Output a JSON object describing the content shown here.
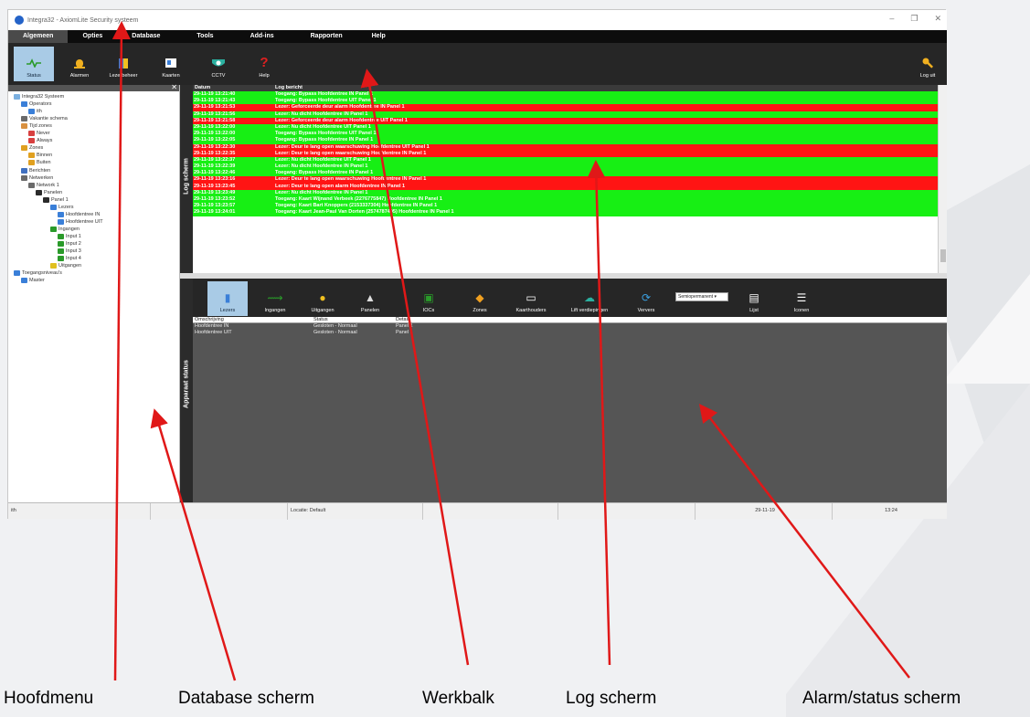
{
  "window": {
    "title": "Integra32 - AxiomLite Security systeem",
    "controls": [
      "–",
      "❐",
      "✕"
    ]
  },
  "menu": [
    "Algemeen",
    "Opties",
    "Database",
    "Tools",
    "Add-ins",
    "Rapporten",
    "Help"
  ],
  "toolbar": {
    "items": [
      {
        "label": "Status",
        "icon": "status-icon"
      },
      {
        "label": "Alarmen",
        "icon": "alarm-icon"
      },
      {
        "label": "Lezerbeheer",
        "icon": "reader-icon"
      },
      {
        "label": "Kaarten",
        "icon": "card-icon"
      },
      {
        "label": "CCTV",
        "icon": "cctv-icon"
      },
      {
        "label": "Help",
        "icon": "help-icon"
      }
    ],
    "logout_label": "Log uit"
  },
  "tree": [
    {
      "label": "Integra32 Systeem",
      "depth": 0
    },
    {
      "label": "Operators",
      "depth": 1
    },
    {
      "label": "ith",
      "depth": 2
    },
    {
      "label": "Vakantie schema",
      "depth": 1
    },
    {
      "label": "Tijd zones",
      "depth": 1
    },
    {
      "label": "Never",
      "depth": 2
    },
    {
      "label": "Always",
      "depth": 2
    },
    {
      "label": "Zones",
      "depth": 1
    },
    {
      "label": "Binnen",
      "depth": 2
    },
    {
      "label": "Buiten",
      "depth": 2
    },
    {
      "label": "Berichten",
      "depth": 1
    },
    {
      "label": "Netwerken",
      "depth": 1
    },
    {
      "label": "Network 1",
      "depth": 2
    },
    {
      "label": "Panelen",
      "depth": 3
    },
    {
      "label": "Panel 1",
      "depth": 4
    },
    {
      "label": "Lezers",
      "depth": 5
    },
    {
      "label": "Hoofdentree IN",
      "depth": 6
    },
    {
      "label": "Hoofdentree UIT",
      "depth": 6
    },
    {
      "label": "Ingangen",
      "depth": 5
    },
    {
      "label": "Input 1",
      "depth": 6
    },
    {
      "label": "Input 2",
      "depth": 6
    },
    {
      "label": "Input 3",
      "depth": 6
    },
    {
      "label": "Input 4",
      "depth": 6
    },
    {
      "label": "Uitgangen",
      "depth": 5
    },
    {
      "label": "Toegangsniveau's",
      "depth": 0
    },
    {
      "label": "Master",
      "depth": 1
    }
  ],
  "log": {
    "side_label": "Log scherm",
    "col_date": "Datum",
    "col_msg": "Log bericht",
    "rows": [
      {
        "d": "29-11-19 13:21:40",
        "m": "Toegang: Bypass Hoofdentree IN Panel 1",
        "c": "g"
      },
      {
        "d": "29-11-19 13:21:43",
        "m": "Toegang: Bypass Hoofdentree UIT Panel 1",
        "c": "g"
      },
      {
        "d": "29-11-19 13:21:53",
        "m": "Lezer: Geforceerde deur alarm Hoofdentree IN Panel 1",
        "c": "r"
      },
      {
        "d": "29-11-19 13:21:56",
        "m": "Lezer: Nu dicht Hoofdentree IN Panel 1",
        "c": "g"
      },
      {
        "d": "29-11-19 13:21:58",
        "m": "Lezer: Geforceerde deur alarm Hoofdentree UIT Panel 1",
        "c": "r"
      },
      {
        "d": "29-11-19 13:22:00",
        "m": "Lezer: Nu dicht Hoofdentree UIT Panel 1",
        "c": "g"
      },
      {
        "d": "29-11-19 13:22:00",
        "m": "Toegang: Bypass Hoofdentree UIT Panel 1",
        "c": "g"
      },
      {
        "d": "29-11-19 13:22:05",
        "m": "Toegang: Bypass Hoofdentree IN Panel 1",
        "c": "g"
      },
      {
        "d": "29-11-19 13:22:30",
        "m": "Lezer: Deur te lang open waarschuwing Hoofdentree UIT Panel 1",
        "c": "r"
      },
      {
        "d": "29-11-19 13:22:35",
        "m": "Lezer: Deur te lang open waarschuwing Hoofdentree IN Panel 1",
        "c": "r"
      },
      {
        "d": "29-11-19 13:22:37",
        "m": "Lezer: Nu dicht Hoofdentree UIT Panel 1",
        "c": "g"
      },
      {
        "d": "29-11-19 13:22:39",
        "m": "Lezer: Nu dicht Hoofdentree IN Panel 1",
        "c": "g"
      },
      {
        "d": "29-11-19 13:22:46",
        "m": "Toegang: Bypass Hoofdentree IN Panel 1",
        "c": "g"
      },
      {
        "d": "29-11-19 13:23:16",
        "m": "Lezer: Deur te lang open waarschuwing Hoofdentree IN Panel 1",
        "c": "r"
      },
      {
        "d": "29-11-19 13:23:45",
        "m": "Lezer: Deur te lang open alarm Hoofdentree IN Panel 1",
        "c": "r"
      },
      {
        "d": "29-11-19 13:23:49",
        "m": "Lezer: Nu dicht Hoofdentree IN Panel 1",
        "c": "g"
      },
      {
        "d": "29-11-19 13:23:52",
        "m": "Toegang: Kaart Wijnand Verbeek (2276775847) Hoofdentree IN Panel 1",
        "c": "g"
      },
      {
        "d": "29-11-19 13:23:57",
        "m": "Toegang: Kaart Bart Knoppers (2153337304) Hoofdentree IN Panel 1",
        "c": "g"
      },
      {
        "d": "29-11-19 13:24:01",
        "m": "Toegang: Kaart Jean-Paul Van Dorten (2574787495) Hoofdentree IN Panel 1",
        "c": "g"
      }
    ]
  },
  "device": {
    "side_label": "Apparaat status",
    "tools": [
      {
        "label": "Lezers",
        "icon": "reader-icon"
      },
      {
        "label": "Ingangen",
        "icon": "input-icon"
      },
      {
        "label": "Uitgangen",
        "icon": "output-icon"
      },
      {
        "label": "Panelen",
        "icon": "panel-icon"
      },
      {
        "label": "IOCs",
        "icon": "ioc-icon"
      },
      {
        "label": "Zones",
        "icon": "zone-icon"
      },
      {
        "label": "Kaarthouders",
        "icon": "cardholder-icon"
      },
      {
        "label": "Lift verdiepingen",
        "icon": "lift-icon"
      },
      {
        "label": "Ververs",
        "icon": "refresh-icon"
      },
      {
        "label": "Lijst",
        "icon": "list-icon"
      },
      {
        "label": "Iconen",
        "icon": "icons-icon"
      }
    ],
    "dropdown": "Semiopermanent",
    "columns": [
      "Omschrijving",
      "Status",
      "Detail"
    ],
    "rows": [
      {
        "name": "Hoofdentree IN",
        "status": "Gesloten - Normaal",
        "detail": "Panel 1"
      },
      {
        "name": "Hoofdentree UIT",
        "status": "Gesloten - Normaal",
        "detail": "Panel 1"
      }
    ]
  },
  "statusbar": {
    "user": "ith",
    "location": "Locatie: Default",
    "date": "29-11-19",
    "time": "13:24"
  },
  "captions": [
    "Hoofdmenu",
    "Database scherm",
    "Werkbalk",
    "Log scherm",
    "Alarm/status scherm"
  ],
  "colors": {
    "log_ok": "#17ef14",
    "log_alarm": "#ff1414",
    "annotation": "#e01818",
    "toolbar_bg": "#262626",
    "active_tool": "#a9cbe6"
  }
}
